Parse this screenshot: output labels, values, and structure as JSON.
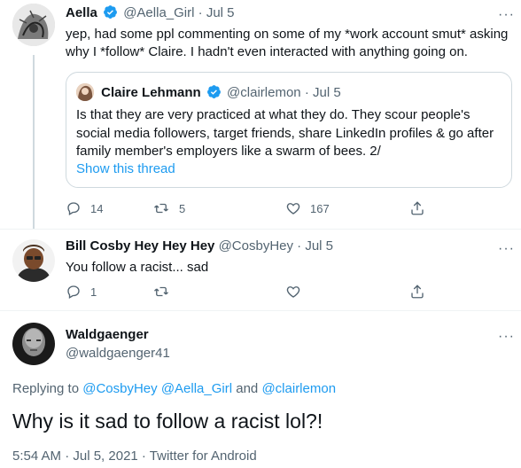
{
  "tweets": [
    {
      "name": "Aella",
      "handle": "@Aella_Girl",
      "dot": "·",
      "time": "Jul 5",
      "text_lines": [
        "yep, had some ppl commenting on some of my *work account smut* asking",
        "why I *follow* Claire. I hadn't even interacted with anything going on."
      ],
      "quote": {
        "name": "Claire Lehmann",
        "handle": "@clairlemon",
        "dot": "·",
        "time": "Jul 5",
        "text_lines": [
          "Is that they are very practiced at what they do. They scour people's",
          "social media followers, target friends, share LinkedIn profiles & go after",
          "family member's employers like a swarm of bees. 2/"
        ],
        "link": "Show this thread"
      },
      "reply_count": "14",
      "retweet_count": "5",
      "like_count": "167"
    },
    {
      "name": "Bill Cosby Hey Hey Hey",
      "handle": "@CosbyHey",
      "dot": "·",
      "time": "Jul 5",
      "text": "You follow a racist... sad",
      "reply_count": "1"
    }
  ],
  "main": {
    "name": "Waldgaenger",
    "handle": "@waldgaenger41",
    "replying_prefix": "Replying to",
    "replying_users": [
      "@CosbyHey",
      "@Aella_Girl",
      "@clairlemon"
    ],
    "replying_and": "and",
    "text": "Why is it sad to follow a racist lol?!",
    "meta": "5:54 AM · Jul 5, 2021 · Twitter for Android"
  },
  "more_label": "···",
  "colors": {
    "accent": "#1d9bf0",
    "secondary": "#536471",
    "text": "#0f1419",
    "border": "#cfd9de"
  },
  "icons": [
    "verified-badge-icon",
    "reply-icon",
    "retweet-icon",
    "like-icon",
    "share-icon",
    "more-icon"
  ]
}
